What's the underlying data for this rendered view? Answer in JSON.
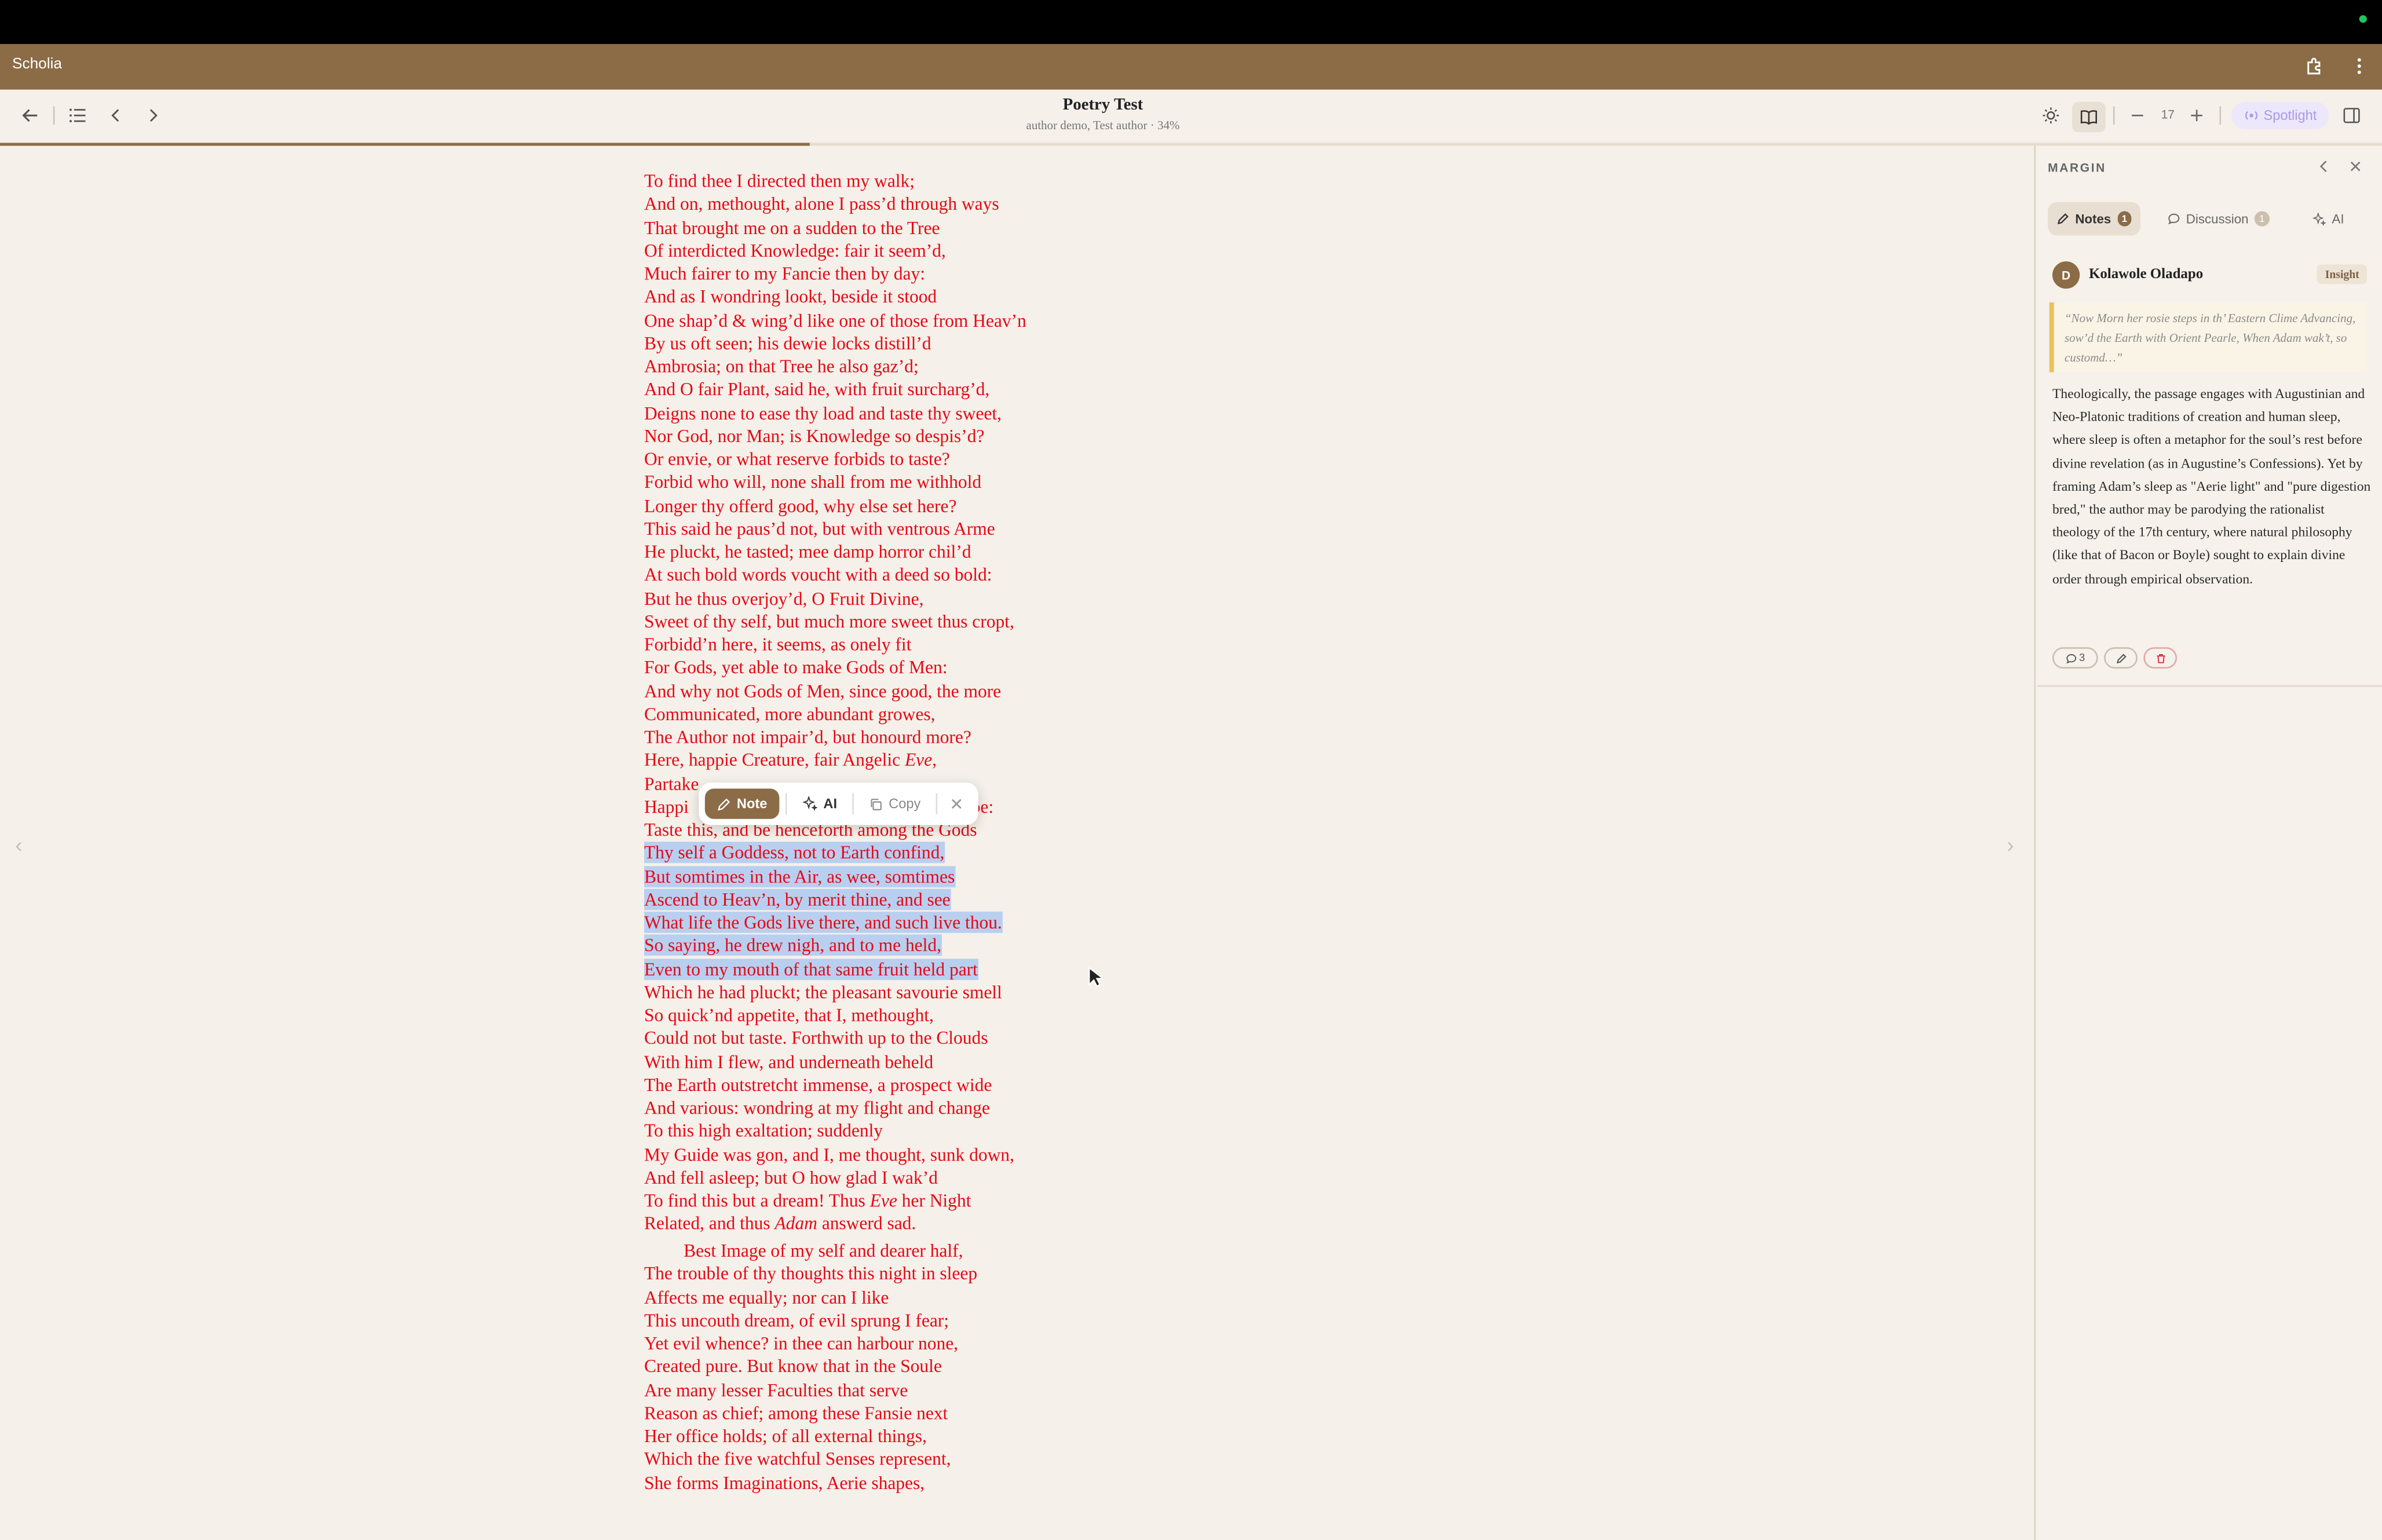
{
  "app": {
    "name": "Scholia"
  },
  "document": {
    "title": "Poetry Test",
    "meta": "author demo, Test author · 34%",
    "progress_percent": 34
  },
  "toolbar": {
    "zoom_value": "17",
    "spotlight_label": "Spotlight"
  },
  "poem": {
    "lines": [
      "To find thee I directed then my walk;",
      "And on, methought, alone I pass’d through ways",
      "That brought me on a sudden to the Tree",
      "Of interdicted Knowledge: fair it seem’d,",
      "Much fairer to my Fancie then by day:",
      "And as I wondring lookt, beside it stood",
      "One shap’d & wing’d like one of those from Heav’n",
      "By us oft seen; his dewie locks distill’d",
      "Ambrosia; on that Tree he also gaz’d;",
      "And O fair Plant, said he, with fruit surcharg’d,",
      "Deigns none to ease thy load and taste thy sweet,",
      "Nor God, nor Man; is Knowledge so despis’d?",
      "Or envie, or what reserve forbids to taste?",
      "Forbid who will, none shall from me withhold",
      "Longer thy offerd good, why else set here?",
      "This said he paus’d not, but with ventrous Arme",
      "He pluckt, he tasted; mee damp horror chil’d",
      "At such bold words voucht with a deed so bold:",
      "But he thus overjoy’d, O Fruit Divine,",
      "Sweet of thy self, but much more sweet thus cropt,",
      "Forbidd’n here, it seems, as onely fit",
      "For Gods, yet able to make Gods of Men:",
      "And why not Gods of Men, since good, the more",
      "Communicated, more abundant growes,",
      "The Author not impair’d, but honourd more?",
      "Here, happie Creature, fair Angelic ",
      "Partake",
      "Happi",
      "Taste this, and be henceforth among the Gods",
      "Thy self a Goddess, not to Earth confind,",
      "But somtimes in the Air, as wee, somtimes",
      "Ascend to Heav’n, by merit thine, and see",
      "What life the Gods live there, and such live thou.",
      "So saying, he drew nigh, and to me held,",
      "Even to my mouth of that same fruit held part",
      "Which he had pluckt; the pleasant savourie smell",
      "So quick’nd appetite, that I, methought,",
      "Could not but taste. Forthwith up to the Clouds",
      "With him I flew, and underneath beheld",
      "The Earth outstretcht immense, a prospect wide",
      "And various: wondring at my flight and change",
      "To this high exaltation; suddenly",
      "My Guide was gon, and I, me thought, sunk down,",
      "And fell asleep; but O how glad I wak’d",
      "To find this but a dream! Thus ",
      "Related, and thus "
    ],
    "eve_word": "Eve",
    "eve_punct": ",",
    "happi_tail": "be:",
    "night_tail": " her Night",
    "adam_word": "Adam",
    "adam_tail": " answerd sad.",
    "stanza2": [
      "Best Image of my self and dearer half,",
      "The trouble of thy thoughts this night in sleep",
      "Affects me equally; nor can I like",
      "This uncouth dream, of evil sprung I fear;",
      "Yet evil whence? in thee can harbour none,",
      "Created pure. But know that in the Soule",
      "Are many lesser Faculties that serve",
      "Reason as chief; among these Fansie next",
      "Her office holds; of all external things,",
      "Which the five watchful Senses represent,",
      "She forms Imaginations, Aerie shapes,"
    ]
  },
  "selection_popover": {
    "note_label": "Note",
    "ai_label": "AI",
    "copy_label": "Copy"
  },
  "margin": {
    "heading": "MARGIN",
    "tabs": [
      {
        "label": "Notes",
        "count": "1"
      },
      {
        "label": "Discussion",
        "count": "1"
      },
      {
        "label": "AI"
      }
    ],
    "note": {
      "avatar_initial": "D",
      "author": "Kolawole Oladapo",
      "tag": "Insight",
      "quote": "“Now Morn her rosie steps in th’ Eastern Clime Advancing, sow’d the Earth with Orient Pearle, When Adam wak’t, so customd…”",
      "body": "Theologically, the passage engages with Augustinian and Neo-Platonic traditions of creation and human sleep, where sleep is often a metaphor for the soul’s rest before divine revelation (as in Augustine’s Confessions). Yet by framing Adam’s sleep as \"Aerie light\" and \"pure digestion bred,\" the author may be parodying the rationalist theology of the 17th century, where natural philosophy (like that of Bacon or Boyle) sought to explain divine order through empirical observation.",
      "reply_count": "3"
    }
  }
}
